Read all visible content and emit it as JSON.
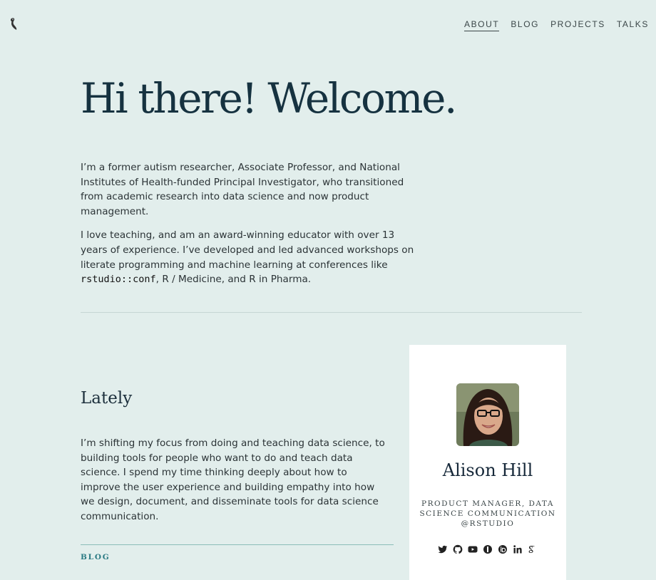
{
  "nav": {
    "items": [
      {
        "label": "ABOUT",
        "active": true
      },
      {
        "label": "BLOG",
        "active": false
      },
      {
        "label": "PROJECTS",
        "active": false
      },
      {
        "label": "TALKS",
        "active": false
      }
    ]
  },
  "hero": {
    "title": "Hi there! Welcome."
  },
  "intro": {
    "p1": "I’m a former autism researcher, Associate Professor, and National Institutes of Health-funded Principal Investigator, who transitioned from academic research into data science and now product management.",
    "p2_before": "I love teaching, and am an award-winning educator with over 13 years of experience. I’ve developed and led advanced workshops on literate programming and machine learning at conferences like ",
    "p2_code": "rstudio::conf",
    "p2_after": ", R / Medicine, and R in Pharma."
  },
  "lately": {
    "title": "Lately",
    "body": "I’m shifting my focus from doing and teaching data science, to building tools for people who want to do and teach data science. I spend my time thinking deeply about how to improve the user experience and building empathy into how we design, document, and disseminate tools for data science communication.",
    "section_label": "BLOG"
  },
  "profile": {
    "name": "Alison Hill",
    "role": "Product Manager, Data Science Communication @RStudio",
    "socials": [
      "twitter-icon",
      "github-icon",
      "youtube-icon",
      "impactstory-icon",
      "orcid-icon",
      "linkedin-icon",
      "google-scholar-icon"
    ]
  },
  "colors": {
    "background": "#e2eeec",
    "accent": "#2a7a83",
    "heading": "#163240",
    "card": "#ffffff"
  }
}
